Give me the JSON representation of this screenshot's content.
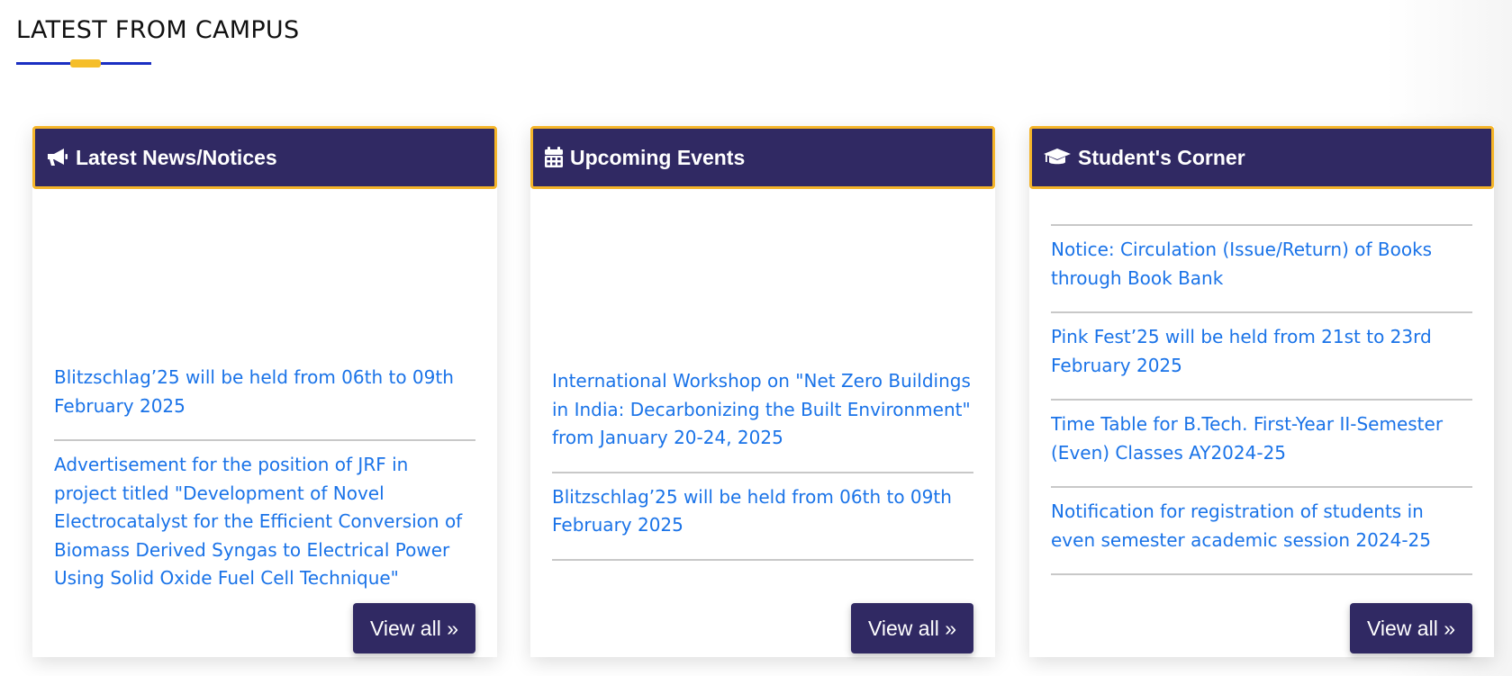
{
  "section": {
    "title": "LATEST FROM CAMPUS"
  },
  "columns": [
    {
      "header": "Latest News/Notices",
      "icon": "megaphone-icon",
      "items": [
        "Blitzschlag’25 will be held from 06th to 09th February 2025",
        "Advertisement for the position of JRF in project titled \"Development of Novel Electrocatalyst for the Efficient Conversion of Biomass Derived Syngas to Electrical Power Using Solid Oxide Fuel Cell Technique\""
      ],
      "view_all": "View all »"
    },
    {
      "header": "Upcoming Events",
      "icon": "calendar-icon",
      "items": [
        "International Workshop on \"Net Zero Buildings in India: Decarbonizing the Built Environment\" from January 20-24, 2025",
        "Blitzschlag’25 will be held from 06th to 09th February 2025"
      ],
      "view_all": "View all »"
    },
    {
      "header": "Student's Corner",
      "icon": "graduation-cap-icon",
      "items": [
        "Notice: Circulation (Issue/Return) of Books through Book Bank",
        "Pink Fest’25 will be held from 21st to 23rd February 2025",
        "Time Table for B.Tech. First-Year II-Semester (Even) Classes AY2024-25",
        "Notification for registration of students in even semester academic session 2024-25"
      ],
      "view_all": "View all »"
    }
  ],
  "colors": {
    "header_bg": "#302963",
    "header_border": "#f5b52a",
    "link": "#1a73e8",
    "accent_blue": "#1b2fc2",
    "accent_yellow": "#f5be2a"
  }
}
